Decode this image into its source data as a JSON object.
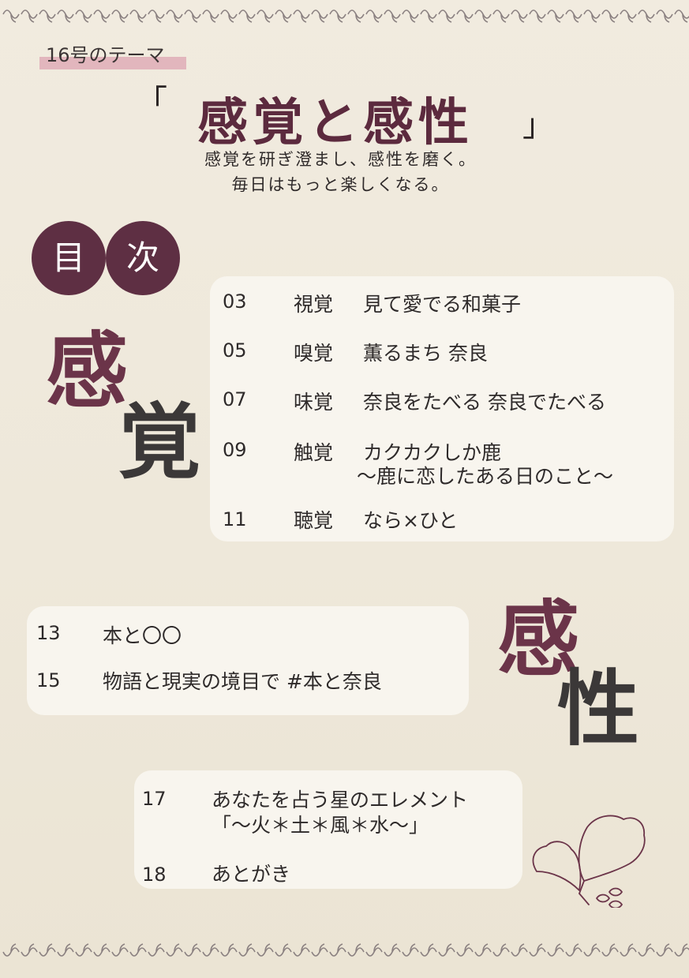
{
  "header": {
    "theme_label": "16号のテーマ",
    "bracket_open": "「",
    "bracket_close": "」",
    "title": "感覚と感性",
    "subtitle_line1": "感覚を研ぎ澄まし、感性を磨く。",
    "subtitle_line2": "毎日はもっと楽しくなる。"
  },
  "toc_heading": {
    "char1": "目",
    "char2": "次"
  },
  "section1": {
    "char1": "感",
    "char2": "覚"
  },
  "section2": {
    "char1": "感",
    "char2": "性"
  },
  "toc_senses": [
    {
      "page": "03",
      "sense": "視覚",
      "title": "見て愛でる和菓子"
    },
    {
      "page": "05",
      "sense": "嗅覚",
      "title": "薫るまち 奈良"
    },
    {
      "page": "07",
      "sense": "味覚",
      "title": "奈良をたべる 奈良でたべる"
    },
    {
      "page": "09",
      "sense": "触覚",
      "title": "カクカクしか鹿",
      "subtitle": "〜鹿に恋したある日のこと〜"
    },
    {
      "page": "11",
      "sense": "聴覚",
      "title": "なら×ひと"
    }
  ],
  "toc_sensibility": [
    {
      "page": "13",
      "title": "本と〇〇"
    },
    {
      "page": "15",
      "title": "物語と現実の境目で #本と奈良"
    }
  ],
  "toc_extra": [
    {
      "page": "17",
      "title": "あなたを占う星のエレメント",
      "subtitle": "「〜火＊土＊風＊水〜」"
    },
    {
      "page": "18",
      "title": "あとがき"
    }
  ],
  "colors": {
    "accent": "#5e2f43",
    "highlight": "#e2b6bd",
    "panel": "#f8f5ee",
    "background": "#efe9dc"
  },
  "icons": [
    "ginkgo-leaf-illustration",
    "scallop-border"
  ]
}
